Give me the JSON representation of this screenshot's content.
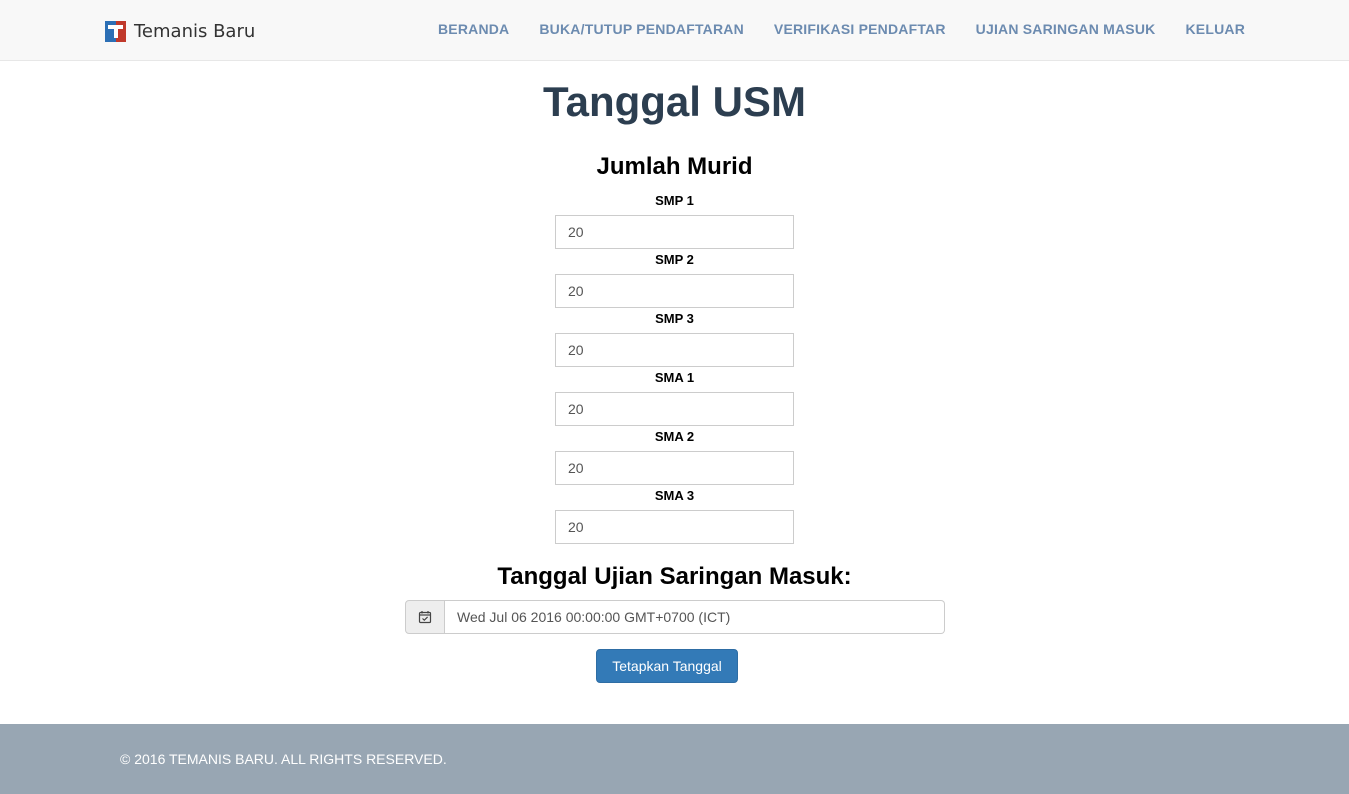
{
  "brand": {
    "name": "Temanis Baru"
  },
  "nav": {
    "items": [
      "BERANDA",
      "BUKA/TUTUP PENDAFTARAN",
      "VERIFIKASI PENDAFTAR",
      "UJIAN SARINGAN MASUK",
      "KELUAR"
    ]
  },
  "page": {
    "title": "Tanggal USM",
    "subtitle": "Jumlah Murid"
  },
  "fields": [
    {
      "label": "SMP 1",
      "value": "20"
    },
    {
      "label": "SMP 2",
      "value": "20"
    },
    {
      "label": "SMP 3",
      "value": "20"
    },
    {
      "label": "SMA 1",
      "value": "20"
    },
    {
      "label": "SMA 2",
      "value": "20"
    },
    {
      "label": "SMA 3",
      "value": "20"
    }
  ],
  "date": {
    "title": "Tanggal Ujian Saringan Masuk:",
    "value": "Wed Jul 06 2016 00:00:00 GMT+0700 (ICT)",
    "icon": "calendar-check-icon"
  },
  "submit": {
    "label": "Tetapkan Tanggal"
  },
  "footer": {
    "text": "© 2016 TEMANIS BARU. ALL RIGHTS RESERVED."
  },
  "colors": {
    "primary": "#337ab7",
    "nav_link": "#6c8bb0",
    "footer_bg": "#98a6b3",
    "title": "#2c3e50"
  }
}
